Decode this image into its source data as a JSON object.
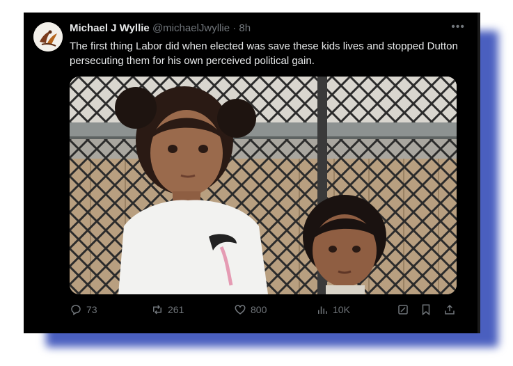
{
  "tweet": {
    "author_name": "Michael J Wyllie",
    "handle": "@michaelJwyllie",
    "separator": "·",
    "time": "8h",
    "text": "The first thing Labor did when elected was save these kids lives and stopped Dutton persecuting them for his own perceived political gain.",
    "more_icon": "more-icon",
    "photo_description_icon": "photo-two-children-in-front-of-fence",
    "actions": {
      "replies": "73",
      "retweets": "261",
      "likes": "800",
      "views": "10K"
    }
  },
  "colors": {
    "card_bg": "#000000",
    "text_primary": "#e7e9ea",
    "text_secondary": "#71767b",
    "shadow": "#4a5fbf"
  }
}
